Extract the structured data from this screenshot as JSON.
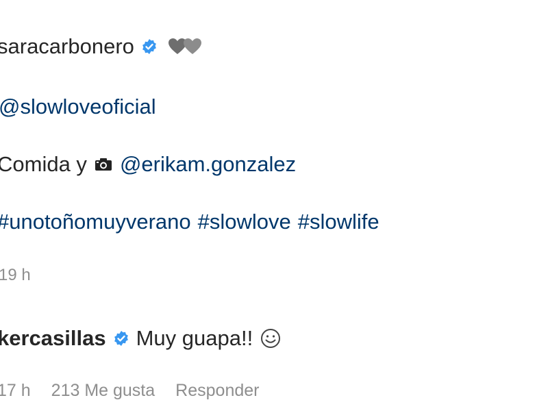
{
  "post": {
    "author": "saracarbonero",
    "mention": "@slowloveoficial",
    "photo_prefix": "Comida y",
    "photo_credit": "@erikam.gonzalez",
    "hashtags": [
      "#unotoñomuyverano",
      "#slowlove",
      "#slowlife"
    ],
    "time": "19 h"
  },
  "comment": {
    "author": "kercasillas",
    "text": "Muy guapa!!",
    "time": "17 h",
    "likes": "213 Me gusta",
    "reply": "Responder"
  },
  "icons": {
    "verified": "verified-badge-icon",
    "hearts": "grey-hearts-emoji",
    "camera": "camera-emoji",
    "smiley": "smiley-emoji"
  },
  "colors": {
    "text": "#262626",
    "link": "#00376b",
    "muted": "#8e8e8e",
    "verified": "#3897f0"
  }
}
